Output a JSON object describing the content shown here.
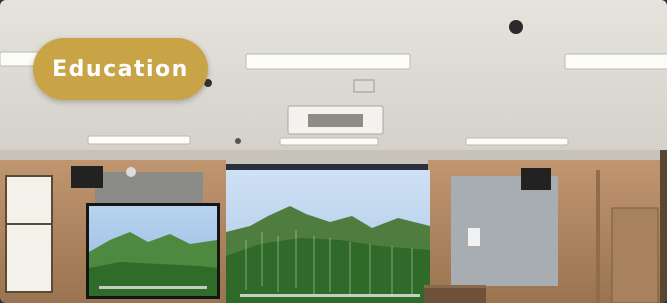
{
  "badge": {
    "label": "Education"
  },
  "colors": {
    "badge": "#c9a447",
    "ceiling": "#ece9e3",
    "wood": "#b5895c",
    "screen_sky": "#b8d2ee",
    "screen_forest": "#3e7a3a"
  }
}
